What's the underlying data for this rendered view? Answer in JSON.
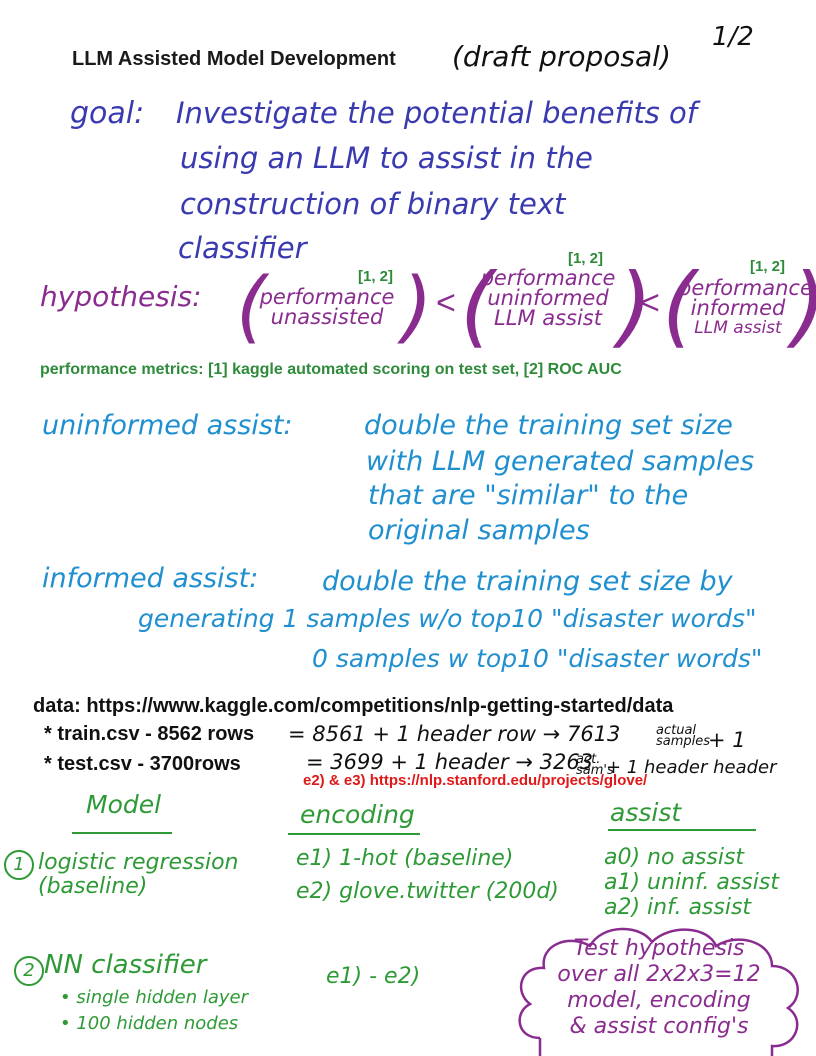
{
  "header": {
    "title": "LLM Assisted Model Development",
    "draft_note": "(draft proposal)",
    "page_number": "1/2"
  },
  "goal": {
    "label": "goal:",
    "lines": [
      "Investigate the potential benefits of",
      "using an LLM to assist in the",
      "construction of binary text",
      "classifier"
    ]
  },
  "hypothesis": {
    "label": "hypothesis:",
    "metric_tag": "[1, 2]",
    "lt": "<",
    "terms": [
      [
        "performance",
        "unassisted"
      ],
      [
        "performance",
        "uninformed",
        "LLM assist"
      ],
      [
        "performance",
        "informed",
        "LLM assist"
      ]
    ]
  },
  "metrics_line": "performance metrics: [1] kaggle automated scoring on test set, [2] ROC AUC",
  "uninformed_assist": {
    "label": "uninformed assist:",
    "lines": [
      "double the training set size",
      "with LLM generated samples",
      "that are \"similar\" to the",
      "original samples"
    ]
  },
  "informed_assist": {
    "label": "informed assist:",
    "lines": [
      "double the training set size by",
      "generating 1 samples w/o top10 \"disaster words\"",
      "0 samples w top10 \"disaster words\""
    ]
  },
  "data": {
    "url_line": "data: https://www.kaggle.com/competitions/nlp-getting-started/data",
    "train": {
      "typed": "* train.csv - 8562 rows",
      "hand": "= 8561 + 1 header row → 7613",
      "small_top": "actual",
      "small_bottom": "samples",
      "tail": "+ 1"
    },
    "test": {
      "typed": "* test.csv   - 3700rows",
      "hand": "= 3699 + 1 header → 3263",
      "small_top": "act.",
      "small_bottom": "sam's",
      "tail": "+ 1 header header"
    },
    "glove_note": "e2) & e3) https://nlp.stanford.edu/projects/glove/"
  },
  "table": {
    "headers": {
      "model": "Model",
      "encoding": "encoding",
      "assist": "assist"
    },
    "models": [
      {
        "num": "1",
        "lines": [
          "logistic regression",
          "(baseline)"
        ]
      },
      {
        "num": "2",
        "lines": [
          "NN classifier"
        ],
        "bullets": [
          "single hidden layer",
          "100 hidden nodes"
        ]
      }
    ],
    "encodings": [
      "e1) 1-hot (baseline)",
      "e2) glove.twitter (200d)"
    ],
    "nn_encodings": "e1) - e2)",
    "assists": [
      "a0) no assist",
      "a1) uninf. assist",
      "a2) inf. assist"
    ]
  },
  "cloud": {
    "lines": [
      "Test hypothesis",
      "over all 2x2x3=12",
      "model, encoding",
      "& assist config's"
    ]
  }
}
